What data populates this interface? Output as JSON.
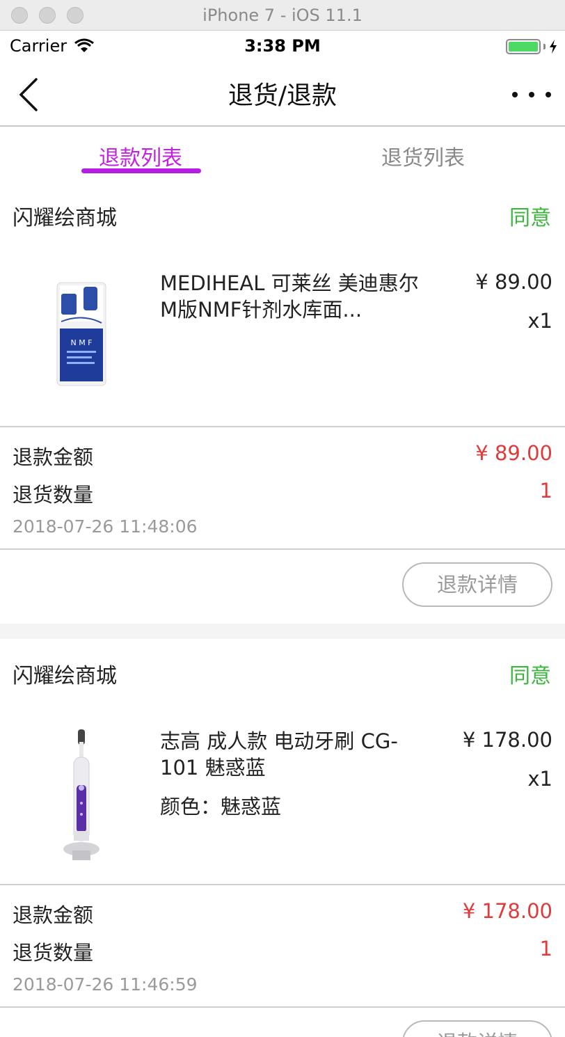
{
  "simulator": {
    "title": "iPhone 7 - iOS 11.1"
  },
  "status_bar": {
    "carrier": "Carrier",
    "time": "3:38 PM"
  },
  "nav": {
    "title": "退货/退款"
  },
  "tabs": [
    {
      "label": "退款列表",
      "active": true
    },
    {
      "label": "退货列表",
      "active": false
    }
  ],
  "orders": [
    {
      "store": "闪耀绘商城",
      "status": "同意",
      "product": {
        "name": "MEDIHEAL 可莱丝 美迪惠尔 M版NMF针剂水库面...",
        "spec": "",
        "price": "¥ 89.00",
        "qty": "x1",
        "image": "face-mask-image"
      },
      "refund_amount_label": "退款金额",
      "refund_amount": "¥ 89.00",
      "return_qty_label": "退货数量",
      "return_qty": "1",
      "time": "2018-07-26 11:48:06",
      "detail_button": "退款详情"
    },
    {
      "store": "闪耀绘商城",
      "status": "同意",
      "product": {
        "name": "志高 成人款 电动牙刷 CG-101 魅惑蓝",
        "spec": "颜色：魅惑蓝",
        "price": "¥ 178.00",
        "qty": "x1",
        "image": "toothbrush-image"
      },
      "refund_amount_label": "退款金额",
      "refund_amount": "¥ 178.00",
      "return_qty_label": "退货数量",
      "return_qty": "1",
      "time": "2018-07-26 11:46:59",
      "detail_button": "退款详情"
    }
  ],
  "colors": {
    "accent": "#c222e0",
    "approved": "#3bb53b",
    "price_red": "#e03a3a"
  }
}
